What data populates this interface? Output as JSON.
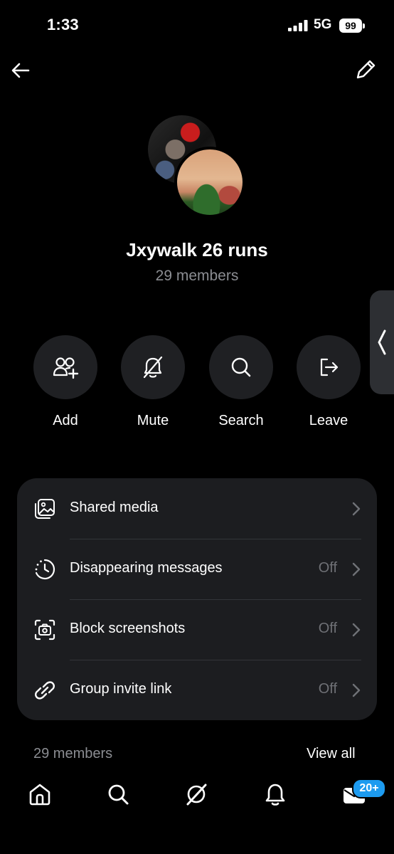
{
  "status_bar": {
    "time": "1:33",
    "network": "5G",
    "battery": "99"
  },
  "group": {
    "name": "Jxywalk 26 runs",
    "member_count": "29 members"
  },
  "actions": [
    {
      "label": "Add",
      "icon": "add-user-icon"
    },
    {
      "label": "Mute",
      "icon": "bell-off-icon"
    },
    {
      "label": "Search",
      "icon": "search-icon"
    },
    {
      "label": "Leave",
      "icon": "leave-icon"
    }
  ],
  "settings": [
    {
      "label": "Shared media",
      "value": "",
      "icon": "media-icon"
    },
    {
      "label": "Disappearing messages",
      "value": "Off",
      "icon": "timer-icon"
    },
    {
      "label": "Block screenshots",
      "value": "Off",
      "icon": "camera-icon"
    },
    {
      "label": "Group invite link",
      "value": "Off",
      "icon": "link-icon"
    }
  ],
  "members_section": {
    "label": "29 members",
    "view_all": "View all"
  },
  "nav": {
    "badge": "20+"
  },
  "colors": {
    "background": "#000000",
    "card": "#1c1d20",
    "accent": "#1d9bf0",
    "muted": "#8b8d92"
  }
}
